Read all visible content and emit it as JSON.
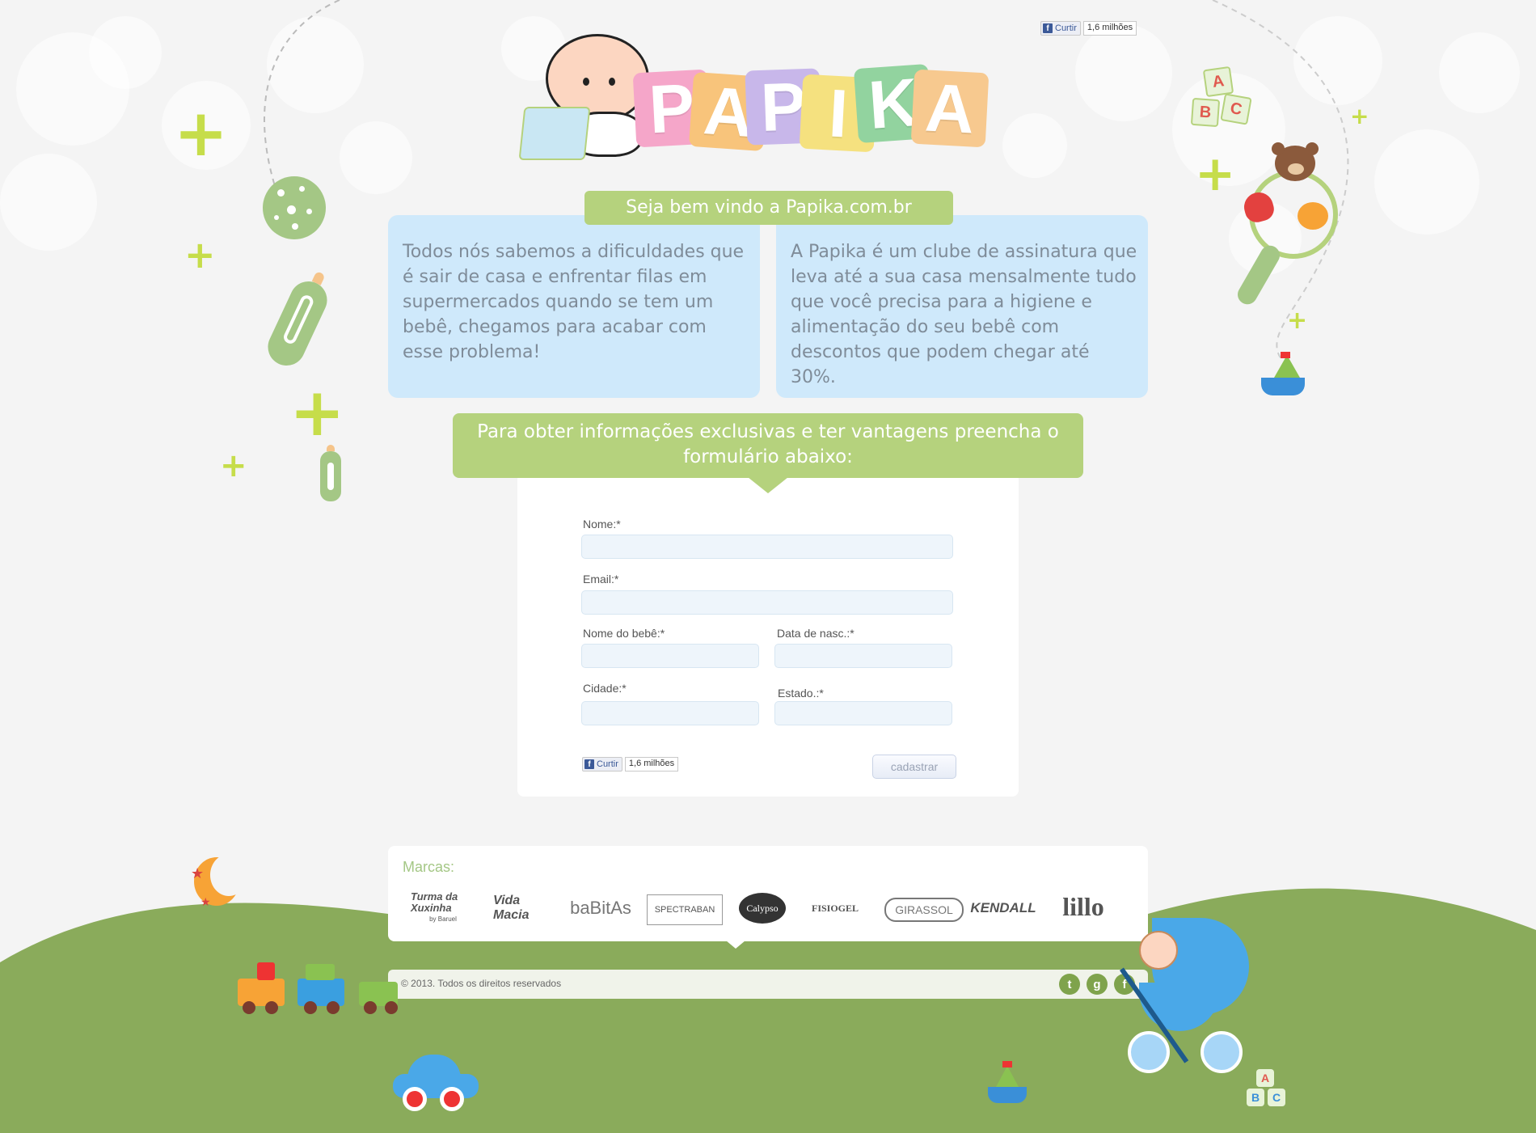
{
  "header": {
    "logo_letters": [
      "P",
      "A",
      "P",
      "I",
      "K",
      "A"
    ],
    "logo_colors": [
      "#f5a6c9",
      "#f8c47b",
      "#c8b7ea",
      "#f5e17f",
      "#92d39f",
      "#80c8d8",
      "#f7c98f"
    ],
    "fb_like": {
      "label": "Curtir",
      "count": "1,6 milhões"
    }
  },
  "welcome": {
    "title": "Seja bem vindo a Papika.com.br",
    "left_text": "Todos nós sabemos a dificuldades que é sair de casa e enfrentar filas em supermercados quando se tem um bebê, chegamos para acabar com esse problema!",
    "right_text": "A Papika é um clube de assinatura que leva até a sua casa mensalmente tudo que você precisa para a higiene e alimentação do seu bebê com descontos que podem chegar até 30%."
  },
  "form": {
    "heading": "Para obter informações exclusivas e ter vantagens preencha o formulário abaixo:",
    "fields": {
      "nome": {
        "label": "Nome:*",
        "value": ""
      },
      "email": {
        "label": "Email:*",
        "value": ""
      },
      "nome_bebe": {
        "label": "Nome do bebê:*",
        "value": ""
      },
      "data_nasc": {
        "label": "Data de nasc.:*",
        "value": ""
      },
      "cidade": {
        "label": "Cidade:*",
        "value": ""
      },
      "estado": {
        "label": "Estado.:*",
        "value": ""
      }
    },
    "fb_like": {
      "label": "Curtir",
      "count": "1,6 milhões"
    },
    "submit_label": "cadastrar"
  },
  "brands": {
    "title": "Marcas:",
    "items": [
      {
        "name": "Turma da Xuxinha",
        "sub": "by Baruel"
      },
      {
        "name": "Vida Macia"
      },
      {
        "name": "baBitAs"
      },
      {
        "name": "SPECTRABAN"
      },
      {
        "name": "Calypso"
      },
      {
        "name": "FISIOGEL"
      },
      {
        "name": "GIRASSOL"
      },
      {
        "name": "KENDALL"
      },
      {
        "name": "lillo"
      }
    ]
  },
  "footer": {
    "copyright": "© 2013. Todos os direitos reservados",
    "social": [
      {
        "name": "twitter-icon",
        "glyph": "t"
      },
      {
        "name": "google-plus-icon",
        "glyph": "g"
      },
      {
        "name": "facebook-icon",
        "glyph": "f"
      }
    ]
  },
  "decor": {
    "abc_letters": [
      "A",
      "B",
      "C"
    ],
    "colors": {
      "green": "#8aab5b",
      "lime": "#c6dd4a",
      "sky": "#cfe9fb",
      "tab": "#b5d27d",
      "stroller": "#4aa8e8"
    }
  }
}
